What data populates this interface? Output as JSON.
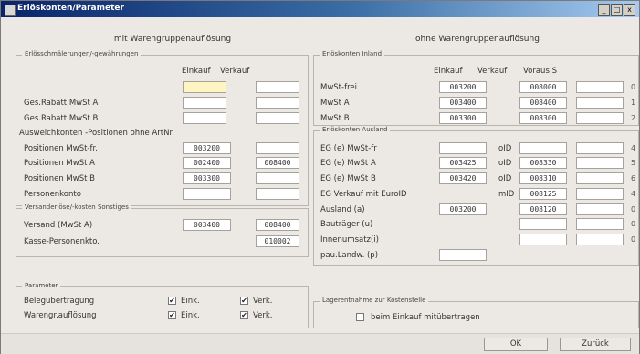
{
  "window": {
    "title": "Erlöskonten/Parameter",
    "btn_min": "_",
    "btn_max": "□",
    "btn_close": "x"
  },
  "left_header": "mit Warengruppenauflösung",
  "right_header": "ohne Warengruppenauflösung",
  "erloes": {
    "title": "Erlösschmälerungen/-gewährungen",
    "col_einkauf": "Einkauf",
    "col_verkauf": "Verkauf",
    "rows": [
      {
        "label": "",
        "einkauf": "",
        "verkauf": ""
      },
      {
        "label": "Ges.Rabatt MwSt A",
        "einkauf": "",
        "verkauf": ""
      },
      {
        "label": "Ges.Rabatt MwSt B",
        "einkauf": "",
        "verkauf": ""
      }
    ]
  },
  "ausweich": {
    "title": "Ausweichkonten -Positionen ohne ArtNr",
    "rows": [
      {
        "label": "Positionen MwSt-fr.",
        "einkauf": "003200",
        "verkauf": ""
      },
      {
        "label": "Positionen MwSt A",
        "einkauf": "002400",
        "verkauf": "008400"
      },
      {
        "label": "Positionen MwSt B",
        "einkauf": "003300",
        "verkauf": ""
      },
      {
        "label": "Personenkonto",
        "einkauf": "",
        "verkauf": ""
      }
    ]
  },
  "versand": {
    "title": "Versanderlöse/-kosten Sonstiges",
    "rows": [
      {
        "label": "Versand (MwSt A)",
        "einkauf": "003400",
        "verkauf": "008400"
      },
      {
        "label": "Kasse-Personenkto.",
        "einkauf": "",
        "verkauf": "010002"
      }
    ]
  },
  "parameter": {
    "title": "Parameter",
    "rows": [
      {
        "label": "Belegübertragung",
        "opt1": "Eink.",
        "opt1_checked": "✔",
        "opt2": "Verk.",
        "opt2_checked": "✔"
      },
      {
        "label": "Warengr.auflösung",
        "opt1": "Eink.",
        "opt1_checked": "✔",
        "opt2": "Verk.",
        "opt2_checked": "✔"
      }
    ]
  },
  "inland": {
    "title": "Erlöskonten Inland",
    "col_einkauf": "Einkauf",
    "col_verkauf": "Verkauf",
    "col_voraus": "Voraus S",
    "rows": [
      {
        "label": "MwSt-frei",
        "einkauf": "003200",
        "verkauf": "008000",
        "voraus": "",
        "idx": "0"
      },
      {
        "label": "MwSt A",
        "einkauf": "003400",
        "verkauf": "008400",
        "voraus": "",
        "idx": "1"
      },
      {
        "label": "MwSt B",
        "einkauf": "003300",
        "verkauf": "008300",
        "voraus": "",
        "idx": "2"
      }
    ]
  },
  "ausland": {
    "title": "Erlöskonten Ausland",
    "rows": [
      {
        "label": "EG (e) MwSt-fr",
        "einkauf": "",
        "uid": "oID",
        "verkauf": "",
        "voraus": "",
        "idx": "4"
      },
      {
        "label": "EG (e) MwSt A",
        "einkauf": "003425",
        "uid": "oID",
        "verkauf": "008330",
        "voraus": "",
        "idx": "5"
      },
      {
        "label": "EG (e) MwSt B",
        "einkauf": "003420",
        "uid": "oID",
        "verkauf": "008310",
        "voraus": "",
        "idx": "6"
      },
      {
        "label": "EG Verkauf mit EuroID",
        "einkauf": "",
        "uid": "mID",
        "verkauf": "008125",
        "voraus": "",
        "idx": "4"
      },
      {
        "label": "Ausland   (a)",
        "einkauf": "003200",
        "uid": "",
        "verkauf": "008120",
        "voraus": "",
        "idx": "0"
      },
      {
        "label": "Bauträger  (u)",
        "einkauf": "",
        "uid": "",
        "verkauf": "",
        "voraus": "",
        "idx": "0"
      },
      {
        "label": "Innenumsatz(i)",
        "einkauf": "",
        "uid": "",
        "verkauf": "",
        "voraus": "",
        "idx": "0"
      },
      {
        "label": "pau.Landw. (p)",
        "einkauf": "",
        "uid": "",
        "verkauf": "",
        "voraus": "",
        "idx": ""
      }
    ]
  },
  "lager": {
    "title": "Lagerentnahme zur Kostenstelle",
    "checkbox_label": "beim Einkauf mitübertragen"
  },
  "buttons": {
    "ok": "OK",
    "back": "Zurück"
  }
}
